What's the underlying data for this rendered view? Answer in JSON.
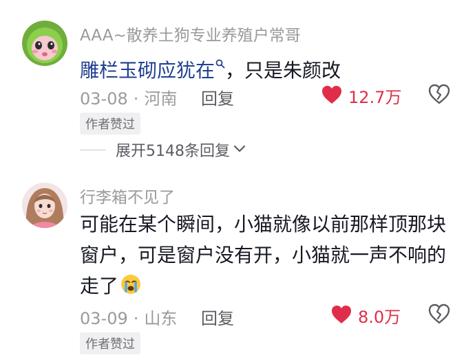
{
  "comments": [
    {
      "username": "AAA~散养土狗专业养殖户常哥",
      "content_link": "雕栏玉砌应犹在",
      "content_rest": "，只是朱颜改",
      "date": "03-08",
      "dot": "·",
      "location": "河南",
      "reply_label": "回复",
      "like_count": "12.7万",
      "author_badge": "作者赞过",
      "expand_label": "展开5148条回复"
    },
    {
      "username": "行李箱不见了",
      "content": "可能在某个瞬间，小猫就像以前那样顶那块窗户，可是窗户没有开，小猫就一声不响的走了",
      "date": "03-09",
      "dot": "·",
      "location": "山东",
      "reply_label": "回复",
      "like_count": "8.0万",
      "author_badge": "作者赞过"
    }
  ],
  "colors": {
    "like_red": "#e02e4a",
    "link_blue": "#1f3f8f",
    "meta_gray": "#9a9a9e"
  }
}
